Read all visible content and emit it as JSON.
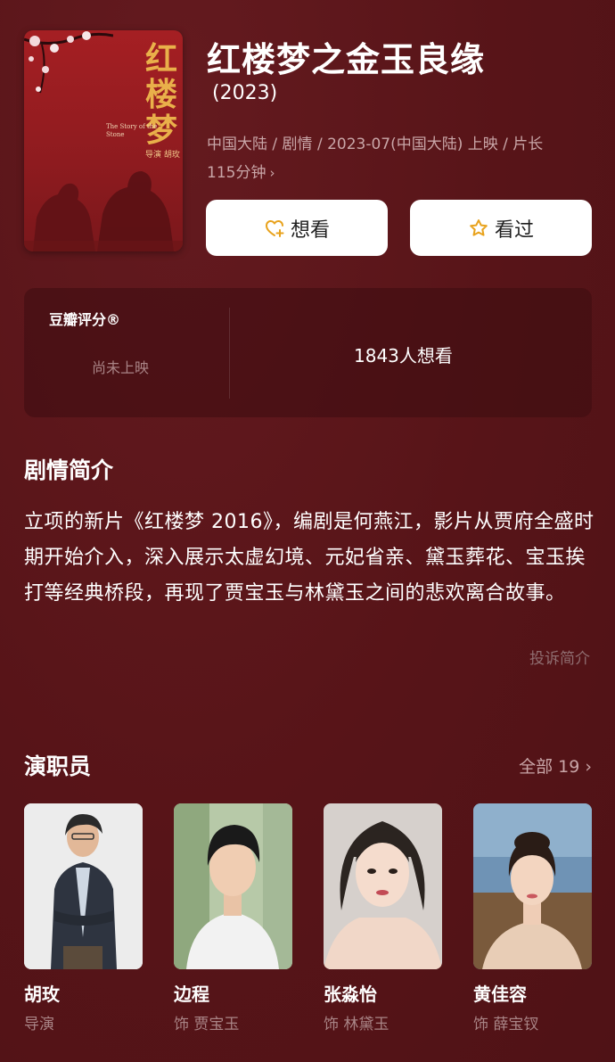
{
  "movie": {
    "title": "红楼梦之金玉良缘",
    "year": "(2023)",
    "meta_line1": "中国大陆 / 剧情 / 2023-07(中国大陆) 上映 / 片长",
    "meta_line2": "115分钟",
    "meta_chevron": "›"
  },
  "poster": {
    "title_art": "红楼梦",
    "subtitle_en": "The Story of the Stone",
    "director_tag": "导演 胡玫"
  },
  "actions": {
    "want_label": "想看",
    "seen_label": "看过"
  },
  "rating": {
    "label": "豆瓣评分®",
    "status": "尚未上映",
    "want_count": "1843人想看"
  },
  "synopsis": {
    "heading": "剧情简介",
    "text": "立项的新片《红楼梦 2016》，编剧是何燕江，影片从贾府全盛时期开始介入，深入展示太虚幻境、元妃省亲、黛玉葬花、宝玉挨打等经典桥段，再现了贾宝玉与林黛玉之间的悲欢离合故事。",
    "report_label": "投诉简介"
  },
  "cast": {
    "heading": "演职员",
    "all_label": "全部 19 ›",
    "members": [
      {
        "name": "胡玫",
        "role": "导演"
      },
      {
        "name": "边程",
        "role": "饰 贾宝玉"
      },
      {
        "name": "张淼怡",
        "role": "饰 林黛玉"
      },
      {
        "name": "黄佳容",
        "role": "饰 薛宝钗"
      }
    ]
  },
  "colors": {
    "background": "#5a1519",
    "card": "#3c0c10",
    "muted_text": "#a98486",
    "button_bg": "#ffffff",
    "star_accent": "#e8a21c"
  }
}
